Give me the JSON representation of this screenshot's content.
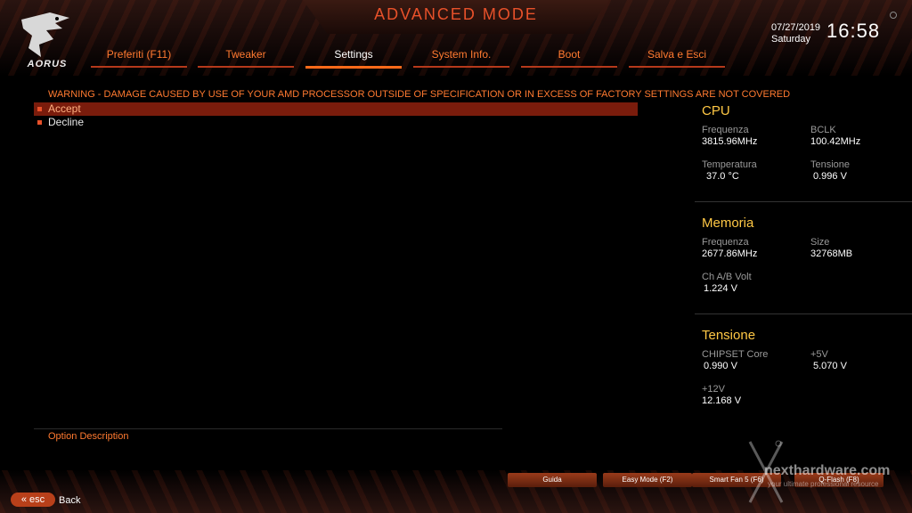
{
  "header": {
    "title": "ADVANCED MODE",
    "logo_text": "AORUS",
    "date": "07/27/2019",
    "day": "Saturday",
    "time": "16:58"
  },
  "tabs": [
    {
      "label": "Preferiti (F11)"
    },
    {
      "label": "Tweaker"
    },
    {
      "label": "Settings",
      "active": true
    },
    {
      "label": "System Info."
    },
    {
      "label": "Boot"
    },
    {
      "label": "Salva e Esci"
    }
  ],
  "main": {
    "warning": "WARNING - DAMAGE CAUSED BY USE OF YOUR AMD PROCESSOR OUTSIDE OF SPECIFICATION OR IN EXCESS OF FACTORY SETTINGS ARE NOT COVERED",
    "options": [
      {
        "label": "Accept",
        "selected": true
      },
      {
        "label": "Decline",
        "selected": false
      }
    ],
    "description_label": "Option Description"
  },
  "sidebar": {
    "cpu": {
      "title": "CPU",
      "freq_label": "Frequenza",
      "freq_value": "3815.96MHz",
      "bclk_label": "BCLK",
      "bclk_value": "100.42MHz",
      "temp_label": "Temperatura",
      "temp_value": "37.0 °C",
      "volt_label": "Tensione",
      "volt_value": "0.996 V"
    },
    "memory": {
      "title": "Memoria",
      "freq_label": "Frequenza",
      "freq_value": "2677.86MHz",
      "size_label": "Size",
      "size_value": "32768MB",
      "volt_label": "Ch A/B Volt",
      "volt_value": "1.224 V"
    },
    "voltage": {
      "title": "Tensione",
      "chipset_label": "CHIPSET Core",
      "chipset_value": "0.990 V",
      "v5_label": "+5V",
      "v5_value": "5.070 V",
      "v12_label": "+12V",
      "v12_value": "12.168 V"
    }
  },
  "footer": {
    "buttons": [
      {
        "label": "Guida"
      },
      {
        "label": "Easy Mode (F2)"
      },
      {
        "label": "Smart Fan 5 (F6)"
      },
      {
        "label": "Q-Flash (F8)"
      }
    ],
    "esc_label": "esc",
    "back_label": "Back"
  },
  "watermark": {
    "text": "nexthardware.com",
    "subtext": "your ultimate professional resource"
  },
  "colors": {
    "accent": "#ff7a30",
    "highlight": "#7a1c0c",
    "section_title": "#ffc845"
  }
}
